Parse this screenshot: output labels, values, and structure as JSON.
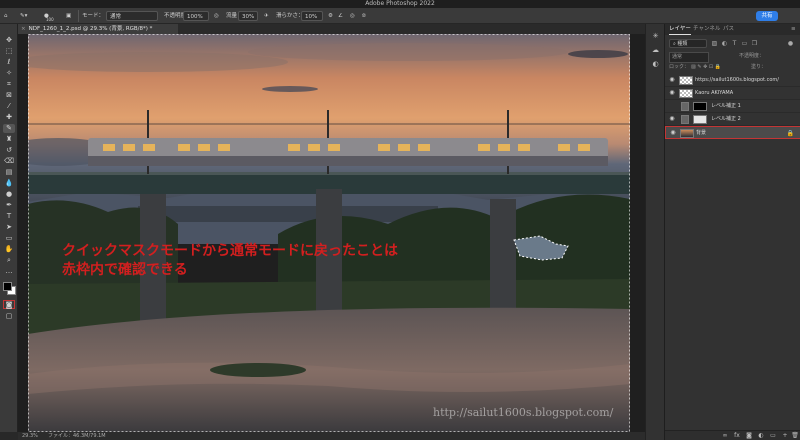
{
  "app": {
    "window_title": "Adobe Photoshop 2022"
  },
  "options_bar": {
    "mode_label": "モード：",
    "mode_value": "通常",
    "opacity_label": "不透明度：",
    "opacity_value": "100%",
    "flow_label": "流量：",
    "flow_value": "30%",
    "smoothing_label": "滑らかさ：",
    "smoothing_value": "10%",
    "brush_size": "100",
    "share_label": "共有"
  },
  "document": {
    "tab_title": "NDF_1260_1_2.psd @ 29.3% (背景, RGB/8*) *",
    "zoom": "29.3%",
    "file_info": "ファイル：46.3M/79.1M"
  },
  "canvas": {
    "annotation_lines": [
      "クイックマスクモードから通常モードに戻ったことは",
      "赤枠内で確認できる"
    ],
    "watermark": "http://sailut1600s.blogspot.com/"
  },
  "layers_panel": {
    "tabs": [
      {
        "label": "レイヤー",
        "active": true
      },
      {
        "label": "チャンネル",
        "active": false
      },
      {
        "label": "パス",
        "active": false
      }
    ],
    "kind_label": "種類",
    "blend_label": "通常",
    "opacity_label": "不透明度：",
    "lock_label": "ロック：",
    "fill_label": "塗り：",
    "layers": [
      {
        "name": "https://sailut1600s.blogspot.com/",
        "visible": true,
        "thumb": "checker",
        "selected": false,
        "locked": false
      },
      {
        "name": "Kaoru AKIYAMA",
        "visible": true,
        "thumb": "checker",
        "selected": false,
        "locked": false
      },
      {
        "name": "レベル補正 1",
        "visible": false,
        "thumb": "mask",
        "selected": false,
        "locked": false
      },
      {
        "name": "レベル補正 2",
        "visible": true,
        "thumb": "adj",
        "selected": false,
        "locked": false
      },
      {
        "name": "背景",
        "visible": true,
        "thumb": "photo",
        "selected": true,
        "locked": true
      }
    ]
  },
  "colors": {
    "annotation_red": "#d31f1f",
    "share_blue": "#2f7ee8",
    "selection_border": "#c43535"
  }
}
